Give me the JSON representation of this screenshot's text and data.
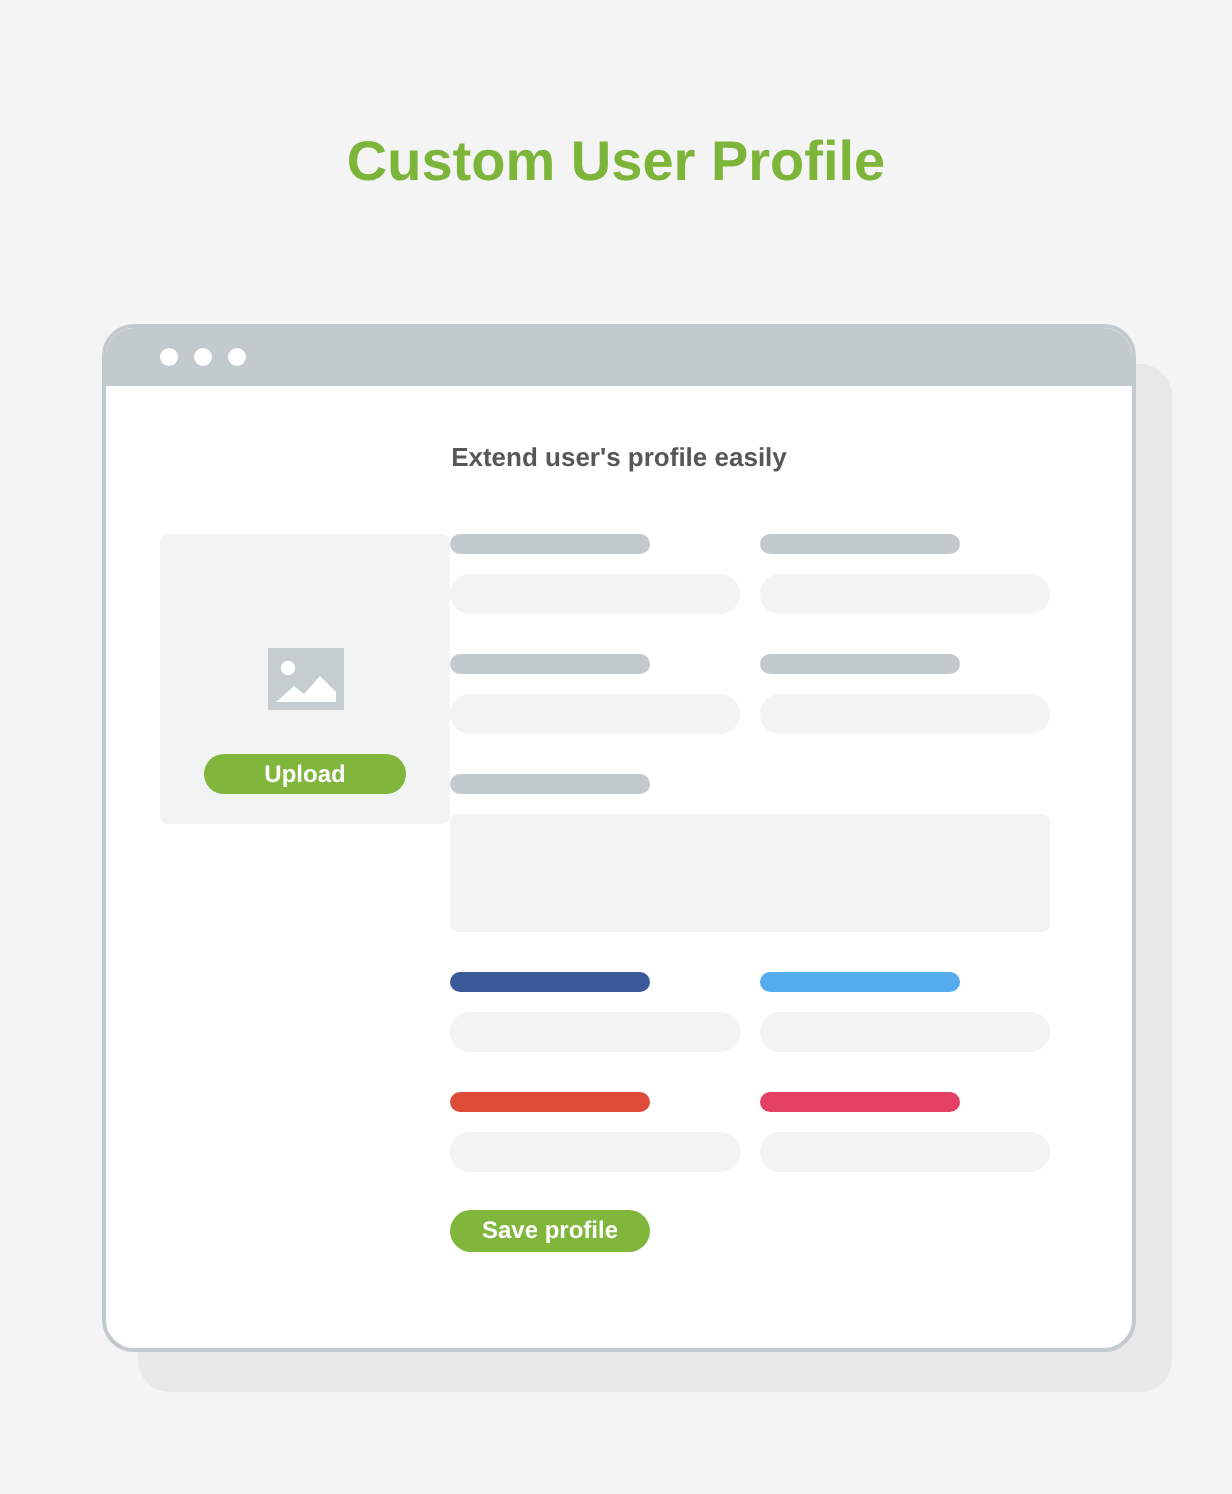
{
  "title": "Custom User Profile",
  "window": {
    "subtitle": "Extend user's profile easily",
    "upload": {
      "button": "Upload"
    },
    "fields": [
      {
        "kind": "input",
        "color": "#c2cacd"
      },
      {
        "kind": "input",
        "color": "#c2cacd"
      },
      {
        "kind": "input",
        "color": "#c2cacd"
      },
      {
        "kind": "input",
        "color": "#c2cacd"
      },
      {
        "kind": "textarea",
        "color": "#c2cacd"
      },
      {
        "kind": "input",
        "color": "#3b5998"
      },
      {
        "kind": "input",
        "color": "#55acee"
      },
      {
        "kind": "input",
        "color": "#dd4b39"
      },
      {
        "kind": "input",
        "color": "#e44063"
      }
    ],
    "save_button": "Save profile"
  }
}
